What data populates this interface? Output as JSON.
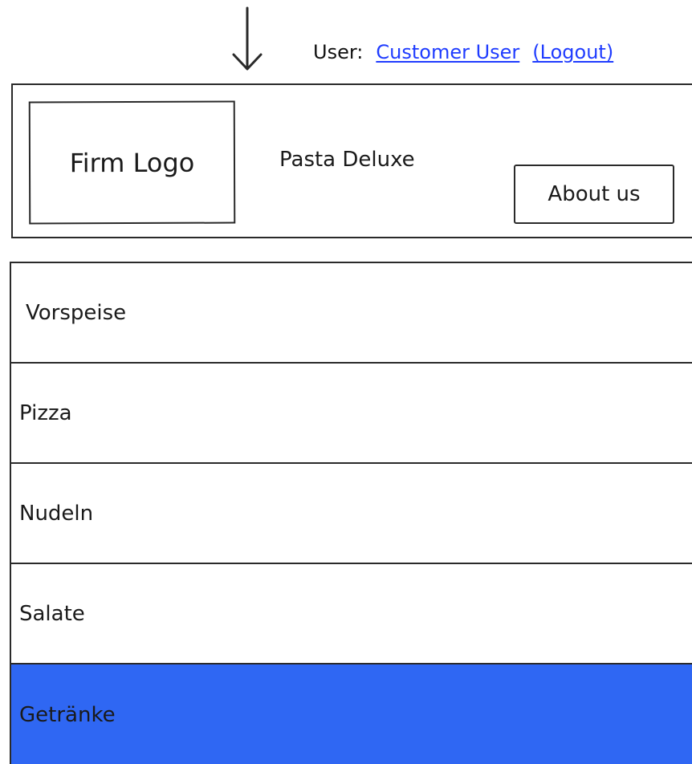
{
  "header": {
    "user_label": "User:",
    "user_name": "Customer User",
    "logout_label": "(Logout)",
    "logo_text": "Firm Logo",
    "brand_name": "Pasta Deluxe",
    "about_label": "About us"
  },
  "menu": {
    "items": [
      {
        "label": "Vorspeise"
      },
      {
        "label": "Pizza"
      },
      {
        "label": "Nudeln"
      },
      {
        "label": "Salate"
      },
      {
        "label": "Getränke",
        "selected": true
      }
    ]
  },
  "colors": {
    "selected_background": "#2f67f3",
    "link": "#1f3cff",
    "outline": "#2a2a2a"
  },
  "icons": {
    "down_arrow": "arrow-down-icon"
  }
}
